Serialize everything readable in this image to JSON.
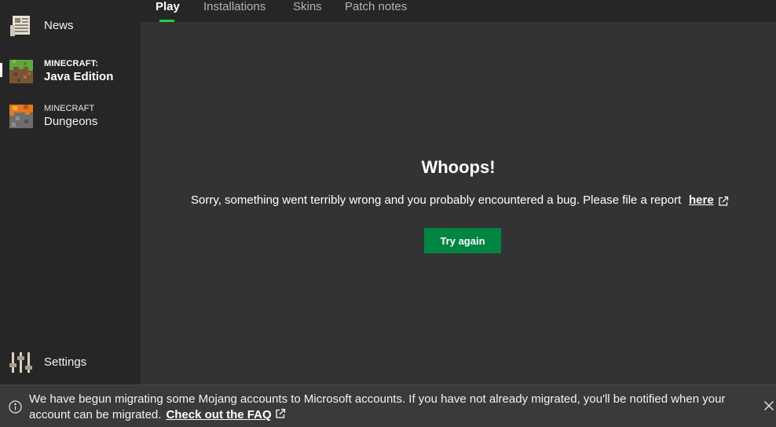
{
  "sidebar": {
    "news_label": "News",
    "java": {
      "sub": "MINECRAFT:",
      "main": "Java Edition"
    },
    "dungeons": {
      "sub": "MINECRAFT",
      "main": "Dungeons"
    },
    "settings_label": "Settings"
  },
  "tabs": [
    {
      "label": "Play",
      "active": true
    },
    {
      "label": "Installations"
    },
    {
      "label": "Skins"
    },
    {
      "label": "Patch notes"
    }
  ],
  "error": {
    "title": "Whoops!",
    "message": "Sorry, something went terribly wrong and you probably encountered a bug. Please file a report",
    "link_label": "here",
    "button_label": "Try again"
  },
  "banner": {
    "text": "We have begun migrating some Mojang accounts to Microsoft accounts. If you have not already migrated, you'll be notified when your account can be migrated.",
    "link_label": "Check out the FAQ"
  },
  "colors": {
    "accent_green": "#008542",
    "tab_underline": "#27ce40",
    "background": "#262626",
    "content_background": "#333333"
  },
  "icons": [
    "news-icon",
    "java-edition-icon",
    "dungeons-icon",
    "settings-icon",
    "external-link-icon",
    "info-icon",
    "close-icon"
  ]
}
